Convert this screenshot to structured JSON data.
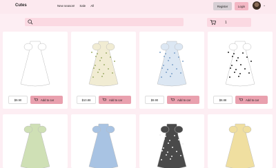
{
  "header": {
    "logo": "Cutes",
    "nav": [
      "New season!",
      "Sale",
      "All"
    ],
    "register_label": "Register",
    "login_label": "Login"
  },
  "search": {
    "placeholder": ""
  },
  "cart": {
    "count": "1"
  },
  "add_label": "Add to car",
  "products": [
    {
      "price": "$9.90",
      "dress_color": "#ffffff",
      "pattern": "plain"
    },
    {
      "price": "$10.88",
      "dress_color": "#f1ecd3",
      "pattern": "floral-yellow"
    },
    {
      "price": "$9.90",
      "dress_color": "#dce7f3",
      "pattern": "floral-blue"
    },
    {
      "price": "$8.88",
      "dress_color": "#ffffff",
      "pattern": "black-dots"
    },
    {
      "price": "",
      "dress_color": "#cfe0b5",
      "pattern": "plain"
    },
    {
      "price": "",
      "dress_color": "#a8c3e3",
      "pattern": "plain"
    },
    {
      "price": "",
      "dress_color": "#4a4a4a",
      "pattern": "white-dots"
    },
    {
      "price": "",
      "dress_color": "#f0dfa0",
      "pattern": "plain"
    }
  ]
}
